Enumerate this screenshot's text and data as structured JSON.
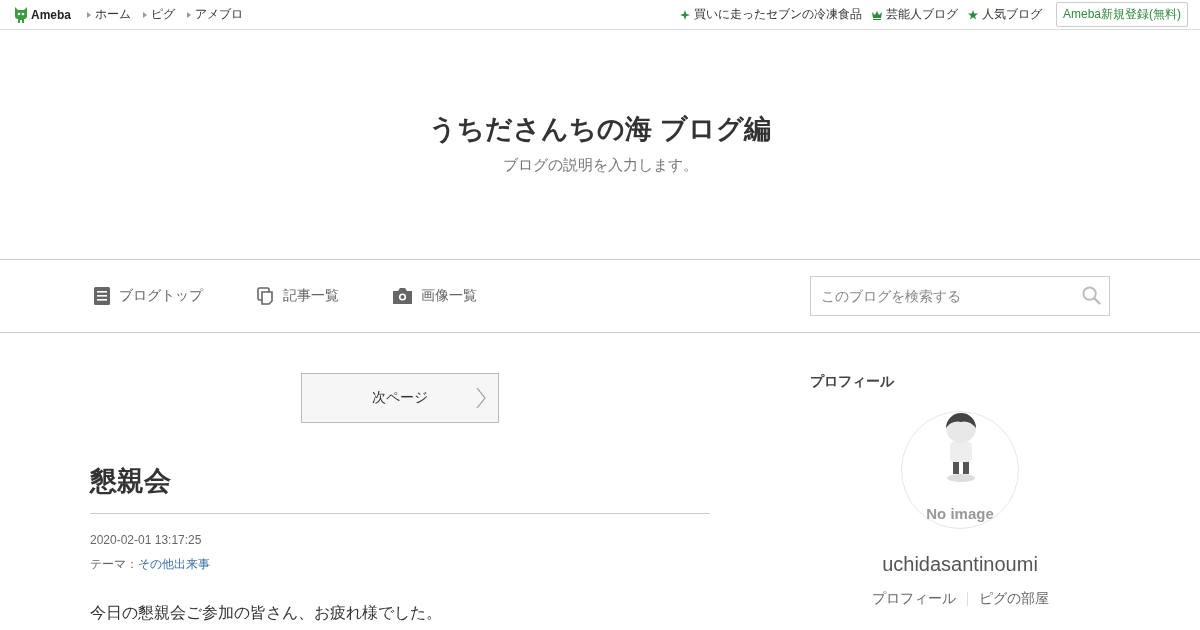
{
  "header": {
    "logo": "Ameba",
    "links": [
      "ホーム",
      "ピグ",
      "アメブロ"
    ],
    "right_links": [
      {
        "kind": "sparkle",
        "label": "買いに走ったセブンの冷凍食品"
      },
      {
        "kind": "crown",
        "label": "芸能人ブログ"
      },
      {
        "kind": "star",
        "label": "人気ブログ"
      }
    ],
    "signup_button": "Ameba新規登録(無料)"
  },
  "blog": {
    "title": "うちださんちの海 ブログ編",
    "description": "ブログの説明を入力します。"
  },
  "nav": {
    "items": [
      {
        "kind": "doc",
        "label": "ブログトップ"
      },
      {
        "kind": "pages",
        "label": "記事一覧"
      },
      {
        "kind": "camera",
        "label": "画像一覧"
      }
    ],
    "search": {
      "placeholder": "このブログを検索する"
    }
  },
  "pager": {
    "next": "次ページ"
  },
  "article": {
    "title": "懇親会",
    "date": "2020-02-01 13:17:25",
    "theme_label": "テーマ：",
    "theme": "その他出来事",
    "body": "今日の懇親会ご参加の皆さん、お疲れ様でした。"
  },
  "profile": {
    "heading": "プロフィール",
    "avatar_caption": "No image",
    "name": "uchidasantinoumi",
    "links": [
      "プロフィール",
      "ピグの部屋"
    ]
  }
}
